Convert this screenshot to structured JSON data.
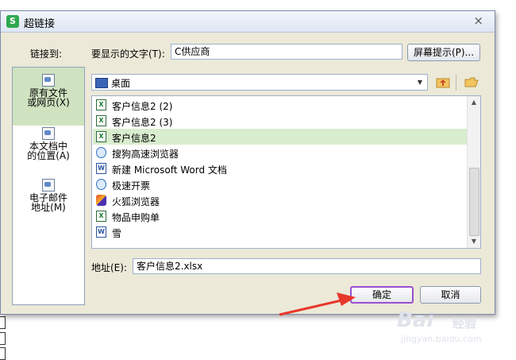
{
  "dialog": {
    "title": "超链接",
    "app_icon": "S",
    "close_glyph": "×",
    "link_to_label": "链接到:",
    "display_text_label": "要显示的文字(T):",
    "display_text_value": "C供应商",
    "screen_tip_button": "屏幕提示(P)...",
    "folder_combo_value": "桌面",
    "address_label": "地址(E):",
    "address_value": "客户信息2.xlsx",
    "ok_button": "确定",
    "cancel_button": "取消"
  },
  "link_targets": [
    {
      "line1": "原有文件",
      "line2": "或网页(X)",
      "icon": "globe-file-icon",
      "selected": true
    },
    {
      "line1": "本文档中",
      "line2": "的位置(A)",
      "icon": "document-place-icon",
      "selected": false
    },
    {
      "line1": "电子邮件",
      "line2": "地址(M)",
      "icon": "email-icon",
      "selected": false
    }
  ],
  "files": [
    {
      "name": "客户信息2 (2)",
      "icon": "xls"
    },
    {
      "name": "客户信息2 (3)",
      "icon": "xls"
    },
    {
      "name": "客户信息2",
      "icon": "xls",
      "selected": true
    },
    {
      "name": "搜狗高速浏览器",
      "icon": "web"
    },
    {
      "name": "新建 Microsoft Word 文档",
      "icon": "doc"
    },
    {
      "name": "极速开票",
      "icon": "web"
    },
    {
      "name": "火狐浏览器",
      "icon": "fox"
    },
    {
      "name": "物品申购单",
      "icon": "xls"
    },
    {
      "name": "雪",
      "icon": "doc"
    }
  ],
  "icons": {
    "folder_up": "folder-up-icon",
    "open_folder": "open-folder-icon",
    "desktop": "desktop-icon"
  },
  "colors": {
    "selection_green": "#d9edcf",
    "annotation_arrow": "#e8372b",
    "ok_button_border": "#9b4fd0"
  },
  "watermark": {
    "brand": "Bai",
    "brand2": "经验",
    "url": "jingyan.baidu.com"
  }
}
